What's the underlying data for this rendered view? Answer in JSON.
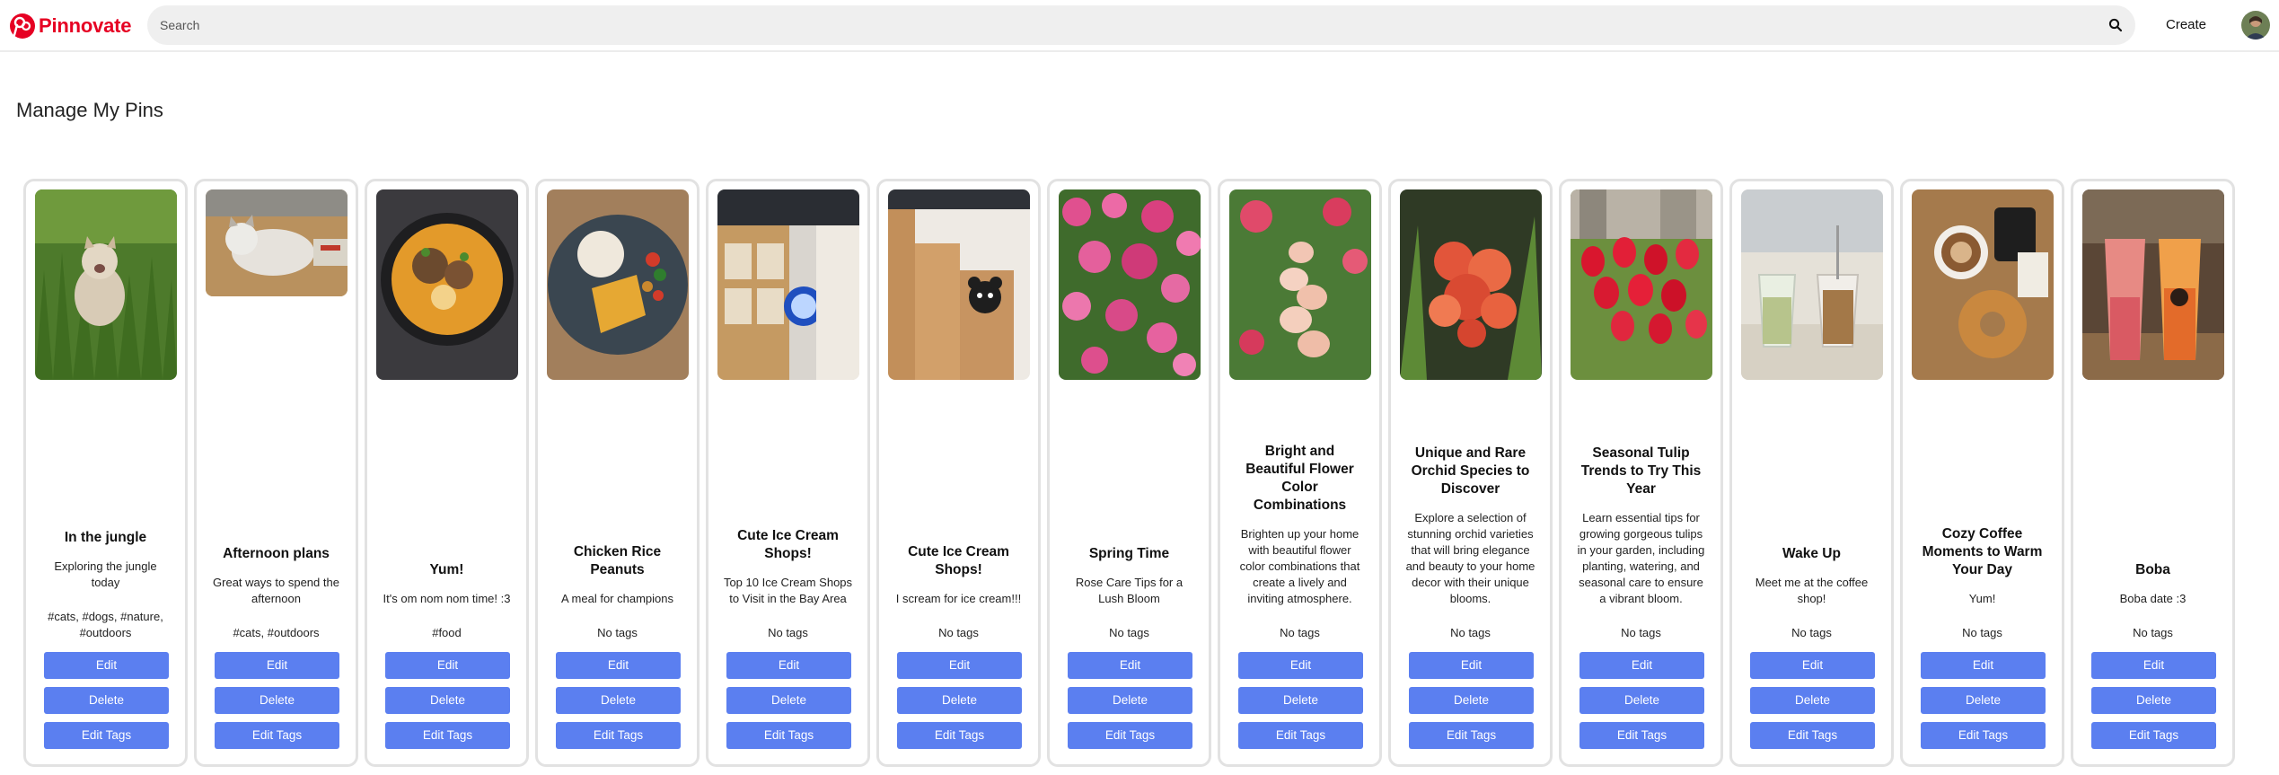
{
  "brand": {
    "name": "Pinnovate",
    "accent": "#e60023"
  },
  "search": {
    "placeholder": "Search"
  },
  "header": {
    "create_label": "Create"
  },
  "page": {
    "title": "Manage My Pins"
  },
  "button_color": "#5b7ff0",
  "pins": [
    {
      "title": "In the jungle",
      "description": "Exploring the jungle today",
      "tags": "#cats, #dogs, #nature, #outdoors",
      "edit": "Edit",
      "delete": "Delete",
      "edit_tags": "Edit Tags",
      "image": "cat-in-grass"
    },
    {
      "title": "Afternoon plans",
      "description": "Great ways to spend the afternoon",
      "tags": "#cats, #outdoors",
      "edit": "Edit",
      "delete": "Delete",
      "edit_tags": "Edit Tags",
      "image": "cat-in-box"
    },
    {
      "title": "Yum!",
      "description": "It's om nom nom time! :3",
      "tags": "#food",
      "edit": "Edit",
      "delete": "Delete",
      "edit_tags": "Edit Tags",
      "image": "noodle-soup"
    },
    {
      "title": "Chicken Rice Peanuts",
      "description": "A meal for champions",
      "tags": "No tags",
      "edit": "Edit",
      "delete": "Delete",
      "edit_tags": "Edit Tags",
      "image": "rice-plate"
    },
    {
      "title": "Cute Ice Cream Shops!",
      "description": "Top 10 Ice Cream Shops to Visit in the Bay Area",
      "tags": "No tags",
      "edit": "Edit",
      "delete": "Delete",
      "edit_tags": "Edit Tags",
      "image": "shop-interior"
    },
    {
      "title": "Cute Ice Cream Shops!",
      "description": "I scream for ice cream!!!",
      "tags": "No tags",
      "edit": "Edit",
      "delete": "Delete",
      "edit_tags": "Edit Tags",
      "image": "shop-bear"
    },
    {
      "title": "Spring Time",
      "description": "Rose Care Tips for a Lush Bloom",
      "tags": "No tags",
      "edit": "Edit",
      "delete": "Delete",
      "edit_tags": "Edit Tags",
      "image": "pink-roses"
    },
    {
      "title": "Bright and Beautiful Flower Color Combinations",
      "description": "Brighten up your home with beautiful flower color combinations that create a lively and inviting atmosphere.",
      "tags": "No tags",
      "edit": "Edit",
      "delete": "Delete",
      "edit_tags": "Edit Tags",
      "image": "foxglove"
    },
    {
      "title": "Unique and Rare Orchid Species to Discover",
      "description": "Explore a selection of stunning orchid varieties that will bring elegance and beauty to your home decor with their unique blooms.",
      "tags": "No tags",
      "edit": "Edit",
      "delete": "Delete",
      "edit_tags": "Edit Tags",
      "image": "orchid"
    },
    {
      "title": "Seasonal Tulip Trends to Try This Year",
      "description": "Learn essential tips for growing gorgeous tulips in your garden, including planting, watering, and seasonal care to ensure a vibrant bloom.",
      "tags": "No tags",
      "edit": "Edit",
      "delete": "Delete",
      "edit_tags": "Edit Tags",
      "image": "tulips"
    },
    {
      "title": "Wake Up",
      "description": "Meet me at the coffee shop!",
      "tags": "No tags",
      "edit": "Edit",
      "delete": "Delete",
      "edit_tags": "Edit Tags",
      "image": "iced-drinks"
    },
    {
      "title": "Cozy Coffee Moments to Warm Your Day",
      "description": "Yum!",
      "tags": "No tags",
      "edit": "Edit",
      "delete": "Delete",
      "edit_tags": "Edit Tags",
      "image": "coffee-donut"
    },
    {
      "title": "Boba",
      "description": "Boba date :3",
      "tags": "No tags",
      "edit": "Edit",
      "delete": "Delete",
      "edit_tags": "Edit Tags",
      "image": "boba-tea"
    }
  ]
}
